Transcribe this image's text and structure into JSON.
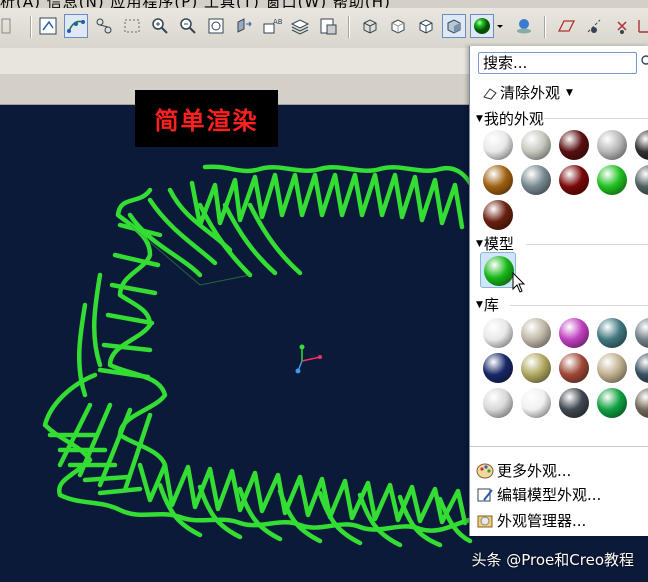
{
  "menubar": {
    "text": "析(A)  信息(N)  应用程序(P)  工具(T)  窗口(W)  帮助(H)"
  },
  "toolbar": {
    "icons": [
      "zoom-fit-icon",
      "spline-icon",
      "graph-icon",
      "select-box-icon",
      "zoom-in-icon",
      "zoom-out-icon",
      "refit-icon",
      "orient-icon",
      "named-view-icon",
      "layers-icon",
      "print-icon",
      "wireframe-icon",
      "hidden-line-icon",
      "no-hidden-icon",
      "shading-icon",
      "appearance-ball-icon",
      "dropdown-arrow-icon",
      "scene-icon",
      "datum-plane-icon",
      "axis-display-icon",
      "point-display-icon",
      "csys-icon"
    ]
  },
  "render_label": "简单渲染",
  "panel": {
    "search_placeholder": "搜索...",
    "clear": "清除外观",
    "my_appearances": "我的外观",
    "model": "模型",
    "library": "库",
    "more": "更多外观...",
    "edit_model": "编辑模型外观...",
    "manager": "外观管理器..."
  },
  "my_balls": [
    {
      "color": "#e8e8e8",
      "name": "white"
    },
    {
      "color": "#c8c8c0",
      "name": "light-gray"
    },
    {
      "color": "#5a1010",
      "name": "dark-red"
    },
    {
      "color": "#b8b8b8",
      "name": "silver-split"
    },
    {
      "color": "#303030",
      "name": "black"
    },
    {
      "color": "#a06010",
      "name": "amber"
    },
    {
      "color": "#788890",
      "name": "steel"
    },
    {
      "color": "#7a0808",
      "name": "maroon"
    },
    {
      "color": "#20c020",
      "name": "green"
    },
    {
      "color": "#506060",
      "name": "slate"
    },
    {
      "color": "#6a2010",
      "name": "brown"
    }
  ],
  "model_balls": [
    {
      "color": "#18b818",
      "name": "green"
    }
  ],
  "library_balls": [
    {
      "color": "#e8e8e8",
      "name": "white"
    },
    {
      "color": "#c0b8a8",
      "name": "pewter"
    },
    {
      "color": "#c040c0",
      "name": "magenta"
    },
    {
      "color": "#407880",
      "name": "teal"
    },
    {
      "color": "#708088",
      "name": "steel-blue"
    },
    {
      "color": "#182868",
      "name": "navy"
    },
    {
      "color": "#b0a860",
      "name": "olive-gold"
    },
    {
      "color": "#a04838",
      "name": "brick"
    },
    {
      "color": "#c0b090",
      "name": "beige"
    },
    {
      "color": "#385060",
      "name": "dark-slate"
    },
    {
      "color": "#d8d8d8",
      "name": "pale-gray"
    },
    {
      "color": "#f0f0f0",
      "name": "white-half"
    },
    {
      "color": "#404850",
      "name": "charcoal"
    },
    {
      "color": "#10a040",
      "name": "emerald"
    },
    {
      "color": "#706858",
      "name": "taupe"
    }
  ],
  "watermark": "头条 @Proe和Creo教程",
  "colors": {
    "viewport_bg": "#0c1a3a",
    "coil": "#33dd33",
    "label_red": "#ff2020"
  }
}
